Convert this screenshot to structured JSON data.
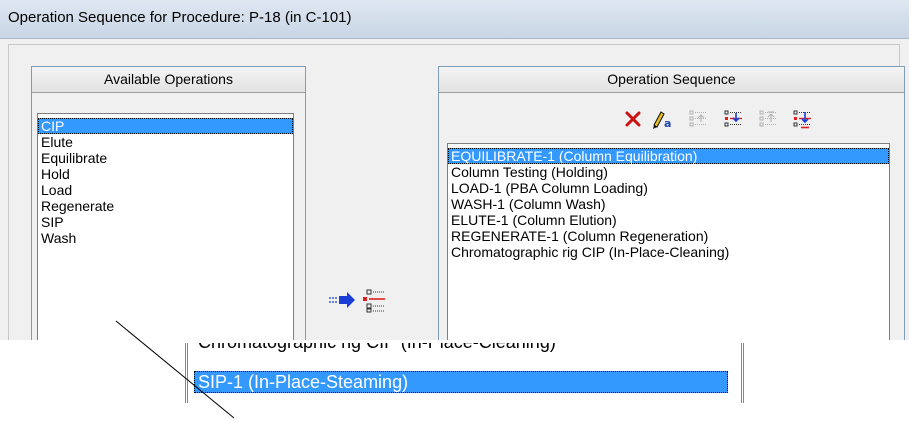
{
  "window": {
    "title": "Operation Sequence for Procedure: P-18 (in C-101)"
  },
  "available": {
    "header": "Available Operations",
    "items": [
      "CIP",
      "Elute",
      "Equilibrate",
      "Hold",
      "Load",
      "Regenerate",
      "SIP",
      "Wash"
    ],
    "selected": "CIP"
  },
  "sequence": {
    "header": "Operation Sequence",
    "toolbar": [
      {
        "name": "delete-icon",
        "color": "#cc1111"
      },
      {
        "name": "rename-icon",
        "color": "#2244aa"
      },
      {
        "name": "move-up-icon",
        "state": "disabled"
      },
      {
        "name": "move-down-icon",
        "state": "enabled"
      },
      {
        "name": "move-top-icon",
        "state": "disabled"
      },
      {
        "name": "move-bottom-icon",
        "state": "enabled"
      }
    ],
    "items": [
      "EQUILIBRATE-1 (Column Equilibration)",
      "Column Testing (Holding)",
      "LOAD-1 (PBA Column Loading)",
      "WASH-1 (Column Wash)",
      "ELUTE-1 (Column Elution)",
      "REGENERATE-1 (Column Regeneration)",
      "Chromatographic rig CIP (In-Place-Cleaning)"
    ],
    "selected": "EQUILIBRATE-1 (Column Equilibration)"
  },
  "add_button": {
    "icon": "add-to-sequence-icon"
  },
  "zoom_inset": {
    "cut_line": "Chromatographic rig CIP (In-Place-Cleaning)",
    "selected": "SIP-1 (In-Place-Steaming)"
  },
  "colors": {
    "selection": "#3399ff",
    "delete": "#cc1111"
  }
}
